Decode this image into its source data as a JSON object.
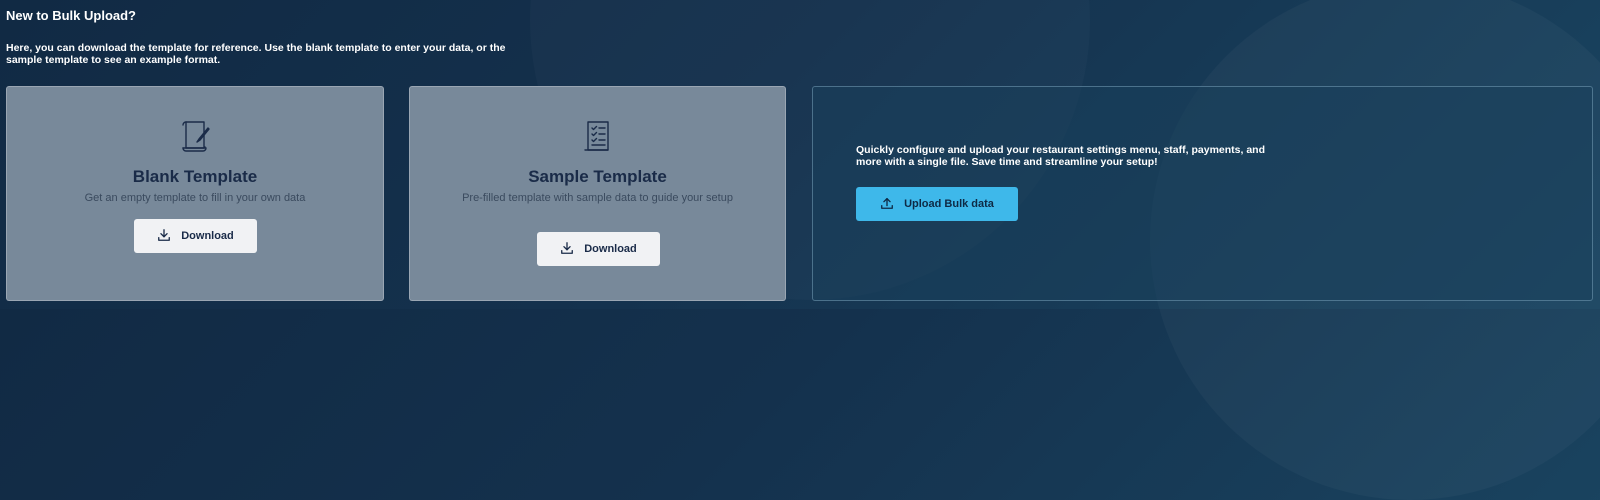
{
  "intro": {
    "title": "New to Bulk Upload?",
    "description": "Here, you can download the template for reference. Use the blank template to enter your data, or the sample template to see an example format."
  },
  "cards": {
    "blank": {
      "icon": "document-edit-icon",
      "title": "Blank Template",
      "subtitle": "Get an empty template to fill in your own data",
      "button_label": "Download",
      "button_icon": "download-icon"
    },
    "sample": {
      "icon": "checklist-document-icon",
      "title": "Sample Template",
      "subtitle": "Pre-filled template with sample data to guide your setup",
      "button_label": "Download",
      "button_icon": "download-icon"
    },
    "upload": {
      "description": "Quickly configure and upload your restaurant settings menu, staff, payments, and more with a single file. Save time and streamline your setup!",
      "button_label": "Upload Bulk data",
      "button_icon": "upload-icon"
    }
  },
  "colors": {
    "background": "#14314d",
    "card_light": "#78899a",
    "accent": "#3eb8ea",
    "title_text": "#1a2b48"
  }
}
